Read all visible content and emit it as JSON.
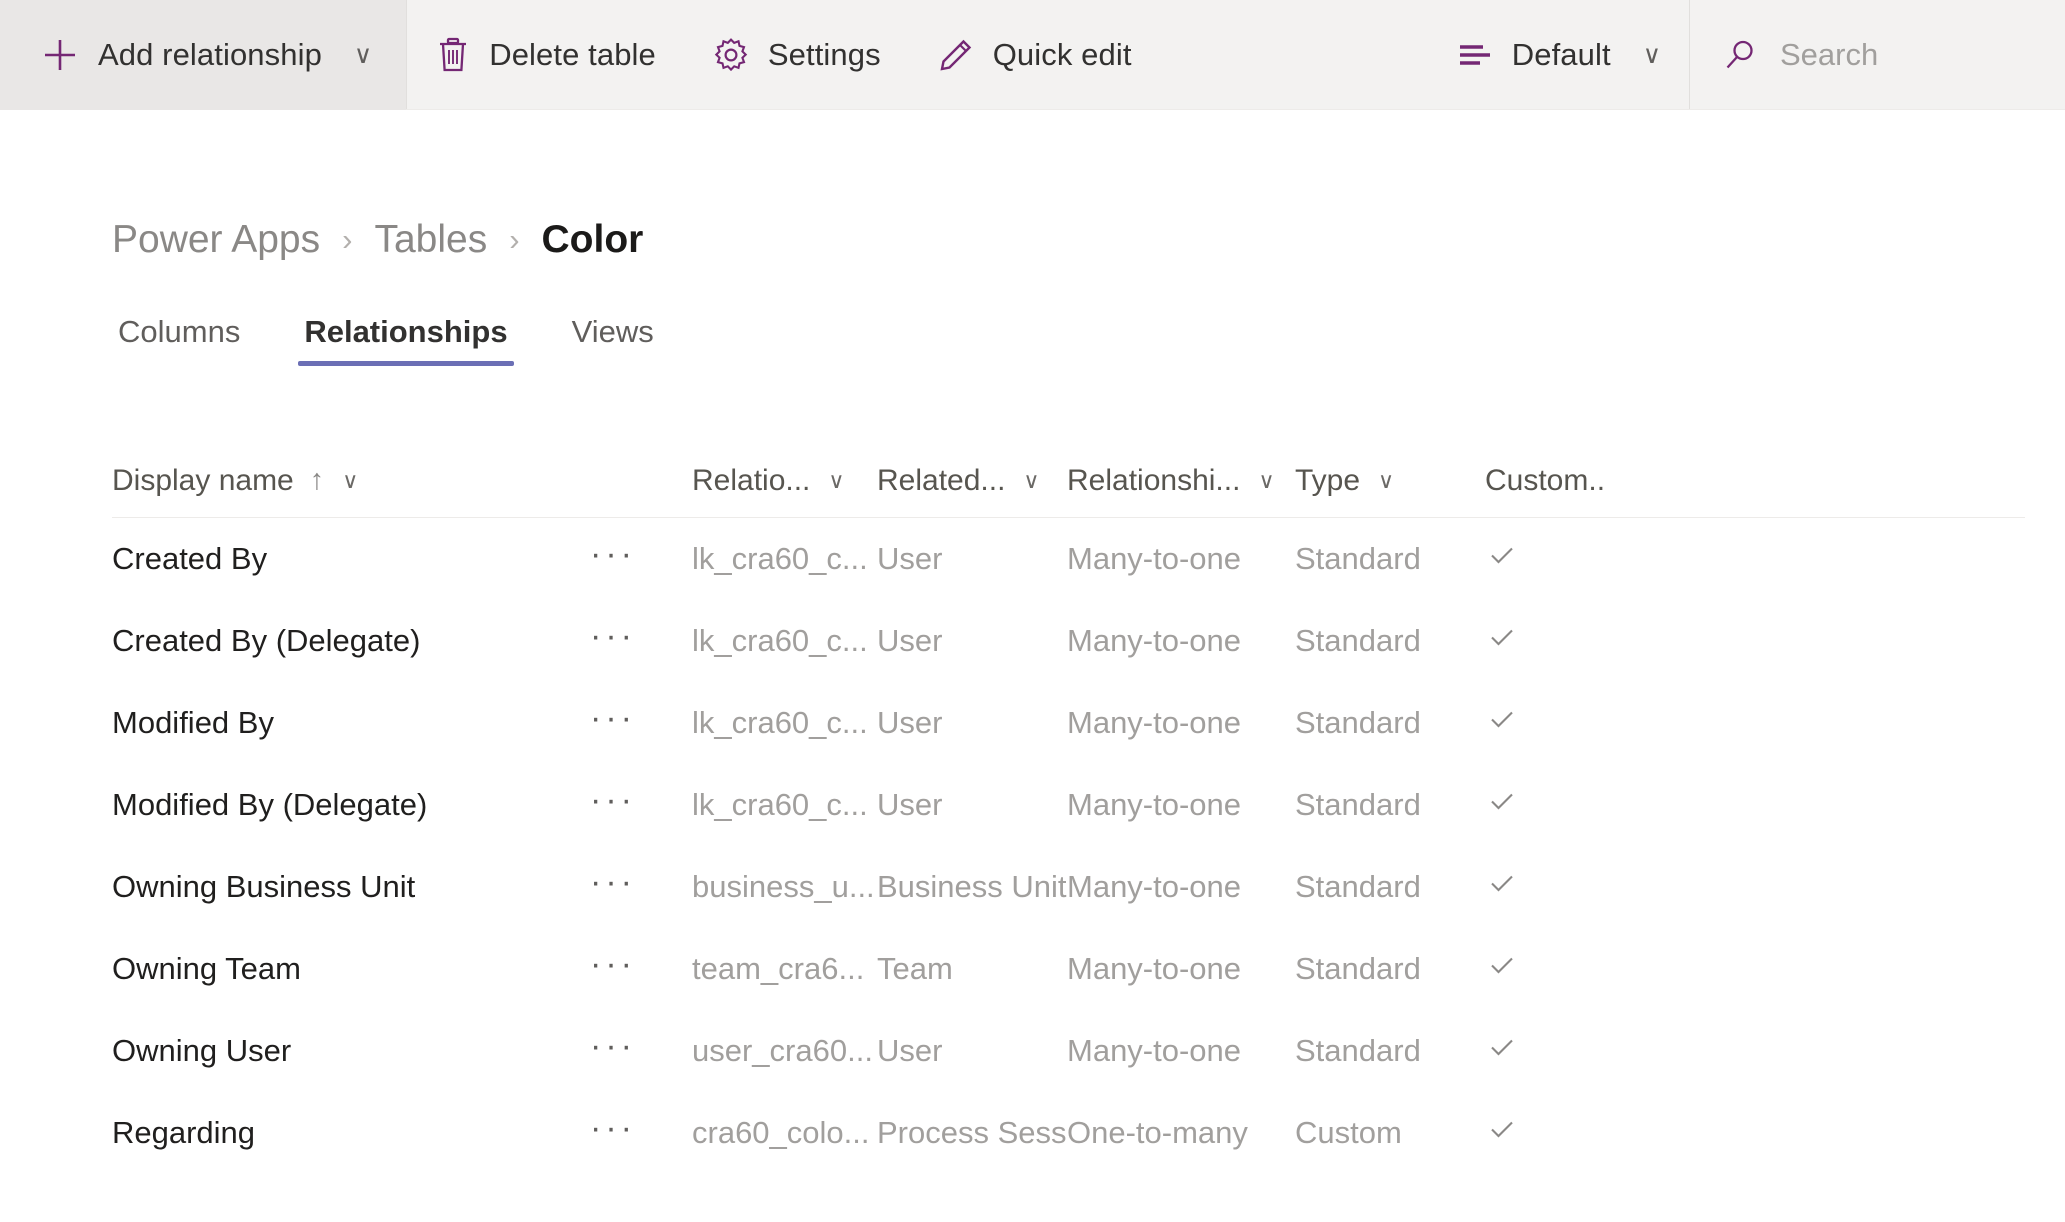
{
  "toolbar": {
    "add_relationship": {
      "label": "Add relationship",
      "icon": "plus-icon",
      "caret": "∨"
    },
    "delete_table": {
      "label": "Delete table",
      "icon": "trash-icon"
    },
    "settings": {
      "label": "Settings",
      "icon": "gear-icon"
    },
    "quick_edit": {
      "label": "Quick edit",
      "icon": "pencil-icon"
    },
    "view_selector": {
      "label": "Default",
      "icon": "list-icon",
      "caret": "∨"
    },
    "search": {
      "placeholder": "Search",
      "icon": "search-icon",
      "value": ""
    }
  },
  "breadcrumb": {
    "items": [
      {
        "label": "Power Apps",
        "current": false
      },
      {
        "label": "Tables",
        "current": false
      },
      {
        "label": "Color",
        "current": true
      }
    ],
    "separator": "›"
  },
  "tabs": [
    {
      "label": "Columns",
      "selected": false
    },
    {
      "label": "Relationships",
      "selected": true
    },
    {
      "label": "Views",
      "selected": false
    }
  ],
  "grid": {
    "columns": [
      {
        "label": "Display name",
        "sort": "↑",
        "caret": "∨"
      },
      {
        "label": "",
        "sort": "",
        "caret": ""
      },
      {
        "label": "Relatio...",
        "sort": "",
        "caret": "∨"
      },
      {
        "label": "Related...",
        "sort": "",
        "caret": "∨"
      },
      {
        "label": "Relationshi...",
        "sort": "",
        "caret": "∨"
      },
      {
        "label": "Type",
        "sort": "",
        "caret": "∨"
      },
      {
        "label": "Custom...",
        "sort": "",
        "caret": "∨"
      }
    ],
    "row_menu_glyph": "···",
    "check_glyph": "✓",
    "rows": [
      {
        "display_name": "Created By",
        "schema": "lk_cra60_c...",
        "related": "User",
        "relationship": "Many-to-one",
        "type": "Standard",
        "customizable": true
      },
      {
        "display_name": "Created By (Delegate)",
        "schema": "lk_cra60_c...",
        "related": "User",
        "relationship": "Many-to-one",
        "type": "Standard",
        "customizable": true
      },
      {
        "display_name": "Modified By",
        "schema": "lk_cra60_c...",
        "related": "User",
        "relationship": "Many-to-one",
        "type": "Standard",
        "customizable": true
      },
      {
        "display_name": "Modified By (Delegate)",
        "schema": "lk_cra60_c...",
        "related": "User",
        "relationship": "Many-to-one",
        "type": "Standard",
        "customizable": true
      },
      {
        "display_name": "Owning Business Unit",
        "schema": "business_u...",
        "related": "Business Unit",
        "relationship": "Many-to-one",
        "type": "Standard",
        "customizable": true
      },
      {
        "display_name": "Owning Team",
        "schema": "team_cra6...",
        "related": "Team",
        "relationship": "Many-to-one",
        "type": "Standard",
        "customizable": true
      },
      {
        "display_name": "Owning User",
        "schema": "user_cra60...",
        "related": "User",
        "relationship": "Many-to-one",
        "type": "Standard",
        "customizable": true
      },
      {
        "display_name": "Regarding",
        "schema": "cra60_colo...",
        "related": "Process Sessi",
        "relationship": "One-to-many",
        "type": "Custom",
        "customizable": true
      }
    ]
  },
  "colors": {
    "accent_purple": "#742774",
    "tab_underline": "#6b6fb5",
    "toolbar_bg": "#f3f2f1",
    "button_active_bg": "#e9e7e6",
    "text_primary": "#201f1e",
    "text_muted": "#a19f9d"
  }
}
